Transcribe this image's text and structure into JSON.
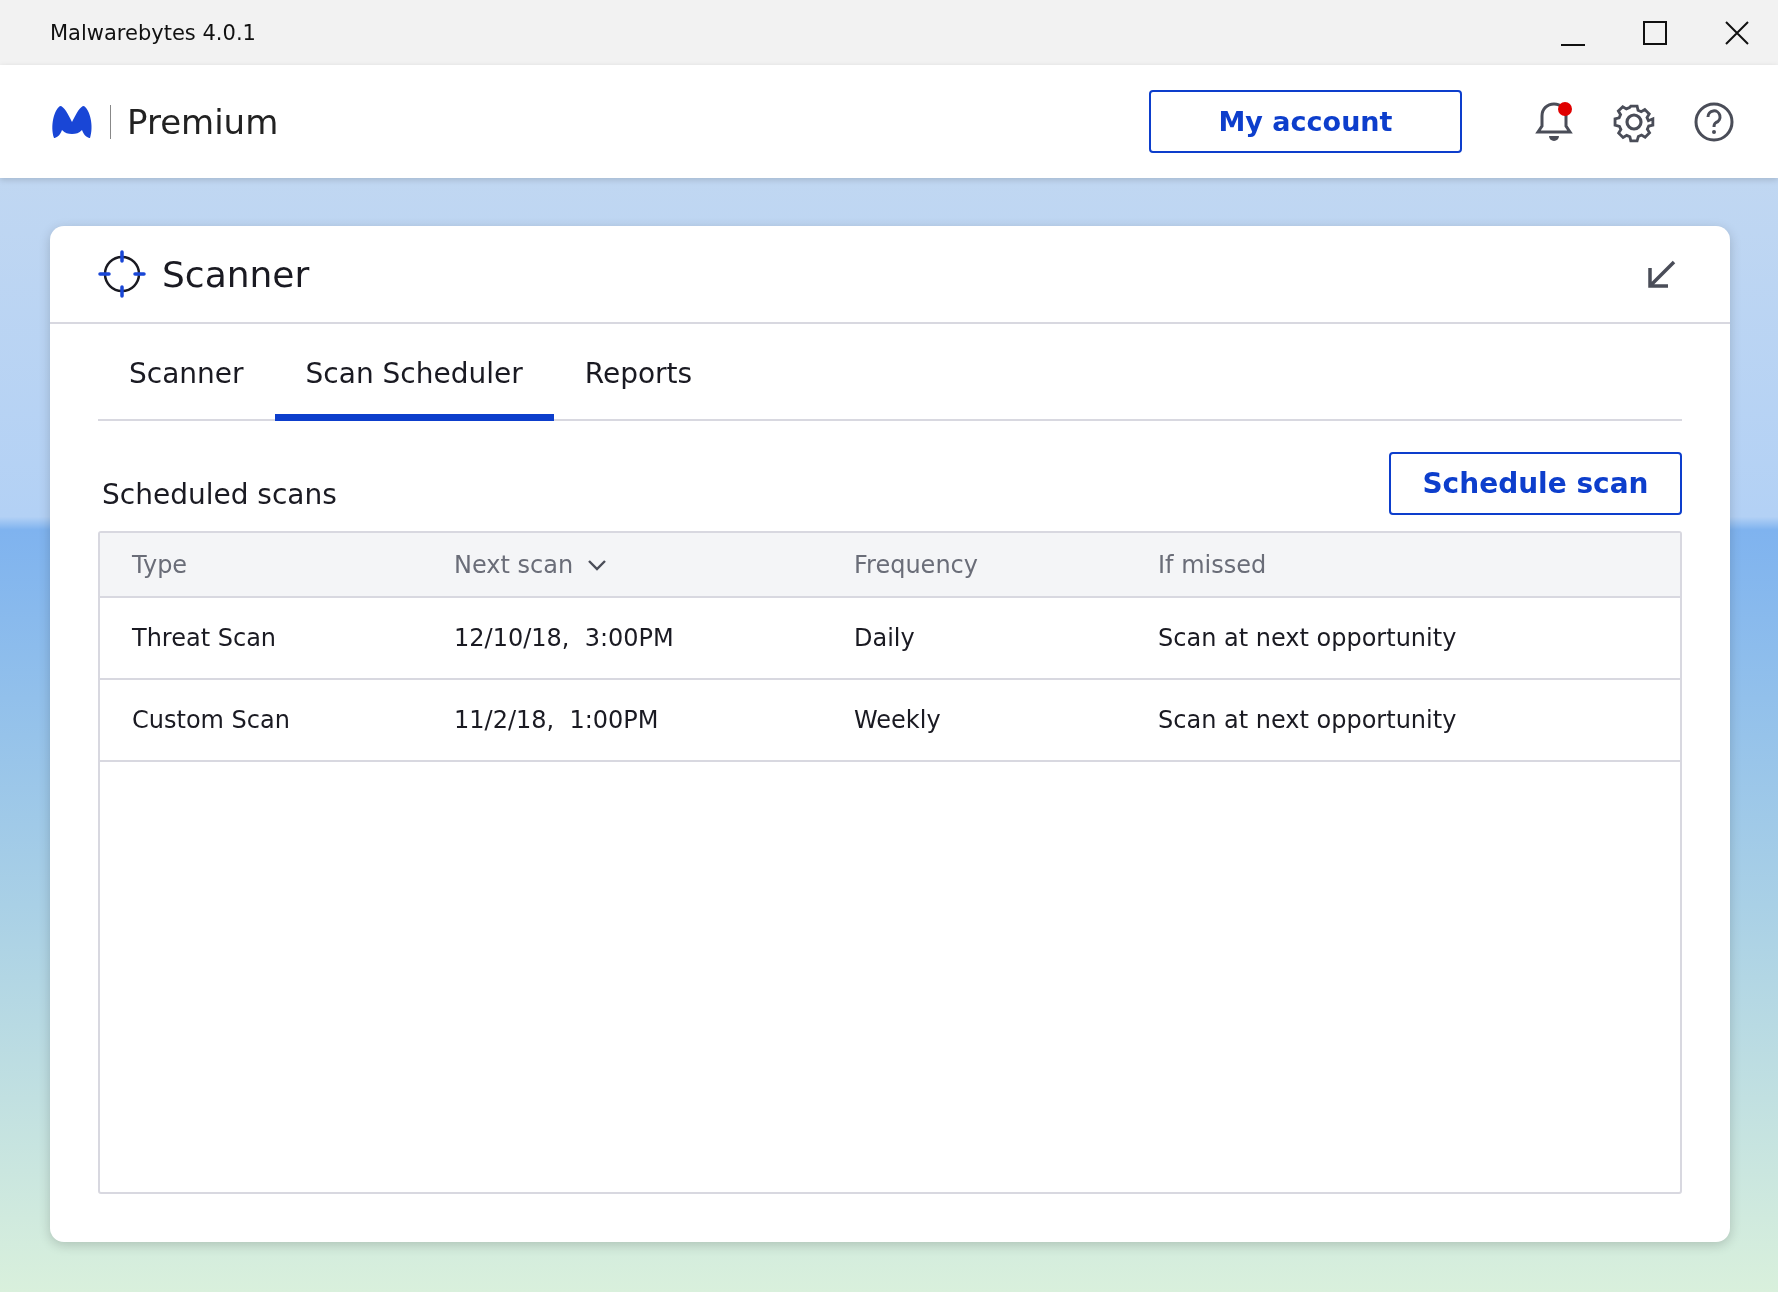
{
  "window": {
    "title": "Malwarebytes 4.0.1"
  },
  "header": {
    "product": "Premium",
    "account_button": "My account",
    "notification_unread": true
  },
  "panel": {
    "title": "Scanner",
    "tabs": [
      {
        "label": "Scanner",
        "selected": false
      },
      {
        "label": "Scan Scheduler",
        "selected": true
      },
      {
        "label": "Reports",
        "selected": false
      }
    ],
    "section_title": "Scheduled scans",
    "schedule_button": "Schedule scan",
    "table": {
      "columns": [
        {
          "label": "Type",
          "sorted": false
        },
        {
          "label": "Next scan",
          "sorted": true
        },
        {
          "label": "Frequency",
          "sorted": false
        },
        {
          "label": "If missed",
          "sorted": false
        }
      ],
      "rows": [
        [
          "Threat Scan",
          "12/10/18,  3:00PM",
          "Daily",
          "Scan at next opportunity"
        ],
        [
          "Custom Scan",
          "11/2/18,  1:00PM",
          "Weekly",
          "Scan at next opportunity"
        ]
      ]
    }
  }
}
